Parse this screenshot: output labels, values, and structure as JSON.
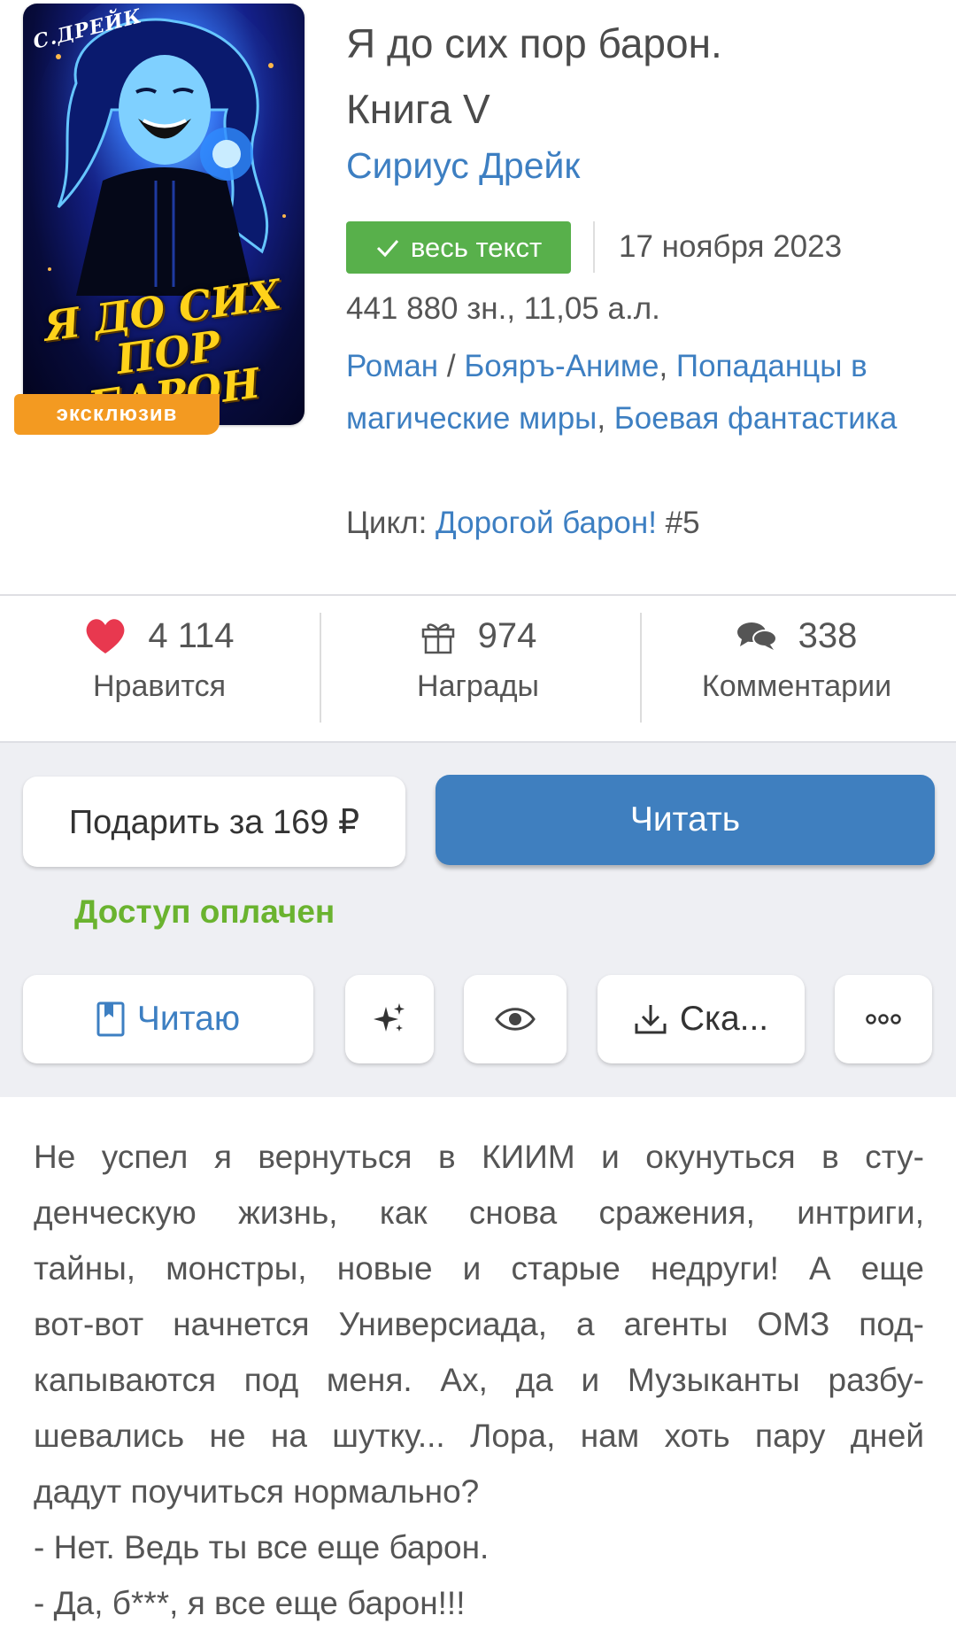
{
  "book": {
    "cover": {
      "author_script": "С.ДРЕЙК",
      "title_art": "Я ДО СИХ ПОР БАРОН"
    },
    "exclusive_badge": "эксклюзив",
    "title_line1": "Я до сих пор барон.",
    "title_line2": "Книга V",
    "author": "Сириус Дрейк",
    "status_badge": "весь текст",
    "date": "17 ноября 2023",
    "size": "441 880 зн., 11,05 а.л.",
    "genres": {
      "main": "Роман",
      "separator": " / ",
      "items": [
        "Бояръ-Аниме",
        "Попаданцы в магические миры",
        "Боевая фантастика"
      ]
    },
    "cycle": {
      "label": "Цикл: ",
      "name": "Дорогой барон!",
      "number": " #5"
    }
  },
  "stats": {
    "likes": {
      "value": "4 114",
      "label": "Нравится",
      "icon": "heart-icon"
    },
    "awards": {
      "value": "974",
      "label": "Награды",
      "icon": "gift-icon"
    },
    "comments": {
      "value": "338",
      "label": "Комментарии",
      "icon": "comments-icon"
    }
  },
  "actions": {
    "gift_button": "Подарить за 169 ₽",
    "read_button": "Читать",
    "access_status": "Доступ оплачен",
    "reading_button": "Читаю",
    "download_button": "Ска...",
    "icons": [
      "bookmark-icon",
      "sparkles-icon",
      "eye-icon",
      "download-icon",
      "more-icon"
    ]
  },
  "description": {
    "lines": [
      "Не успел я вернуться в КИИМ и окунуться в сту-",
      "денческую жизнь, как снова сражения, интриги,",
      "тайны, монстры, новые и старые недруги! А еще",
      "вот-вот начнется Универсиада, а агенты ОМЗ под-",
      "капываются под меня. Ах, да и Музыканты разбу-",
      "шевались не на шутку... Лора, нам хоть пару дней",
      "дадут поучиться нормально?",
      "- Нет. Ведь ты все еще барон.",
      "- Да, б***, я все еще барон!!!"
    ]
  },
  "colors": {
    "link": "#3d7fc2",
    "primary_button": "#3f7fbf",
    "status_green": "#58b04b",
    "access_green": "#6ab32f",
    "exclusive_orange": "#f39a21",
    "heart_red": "#e8384f"
  }
}
